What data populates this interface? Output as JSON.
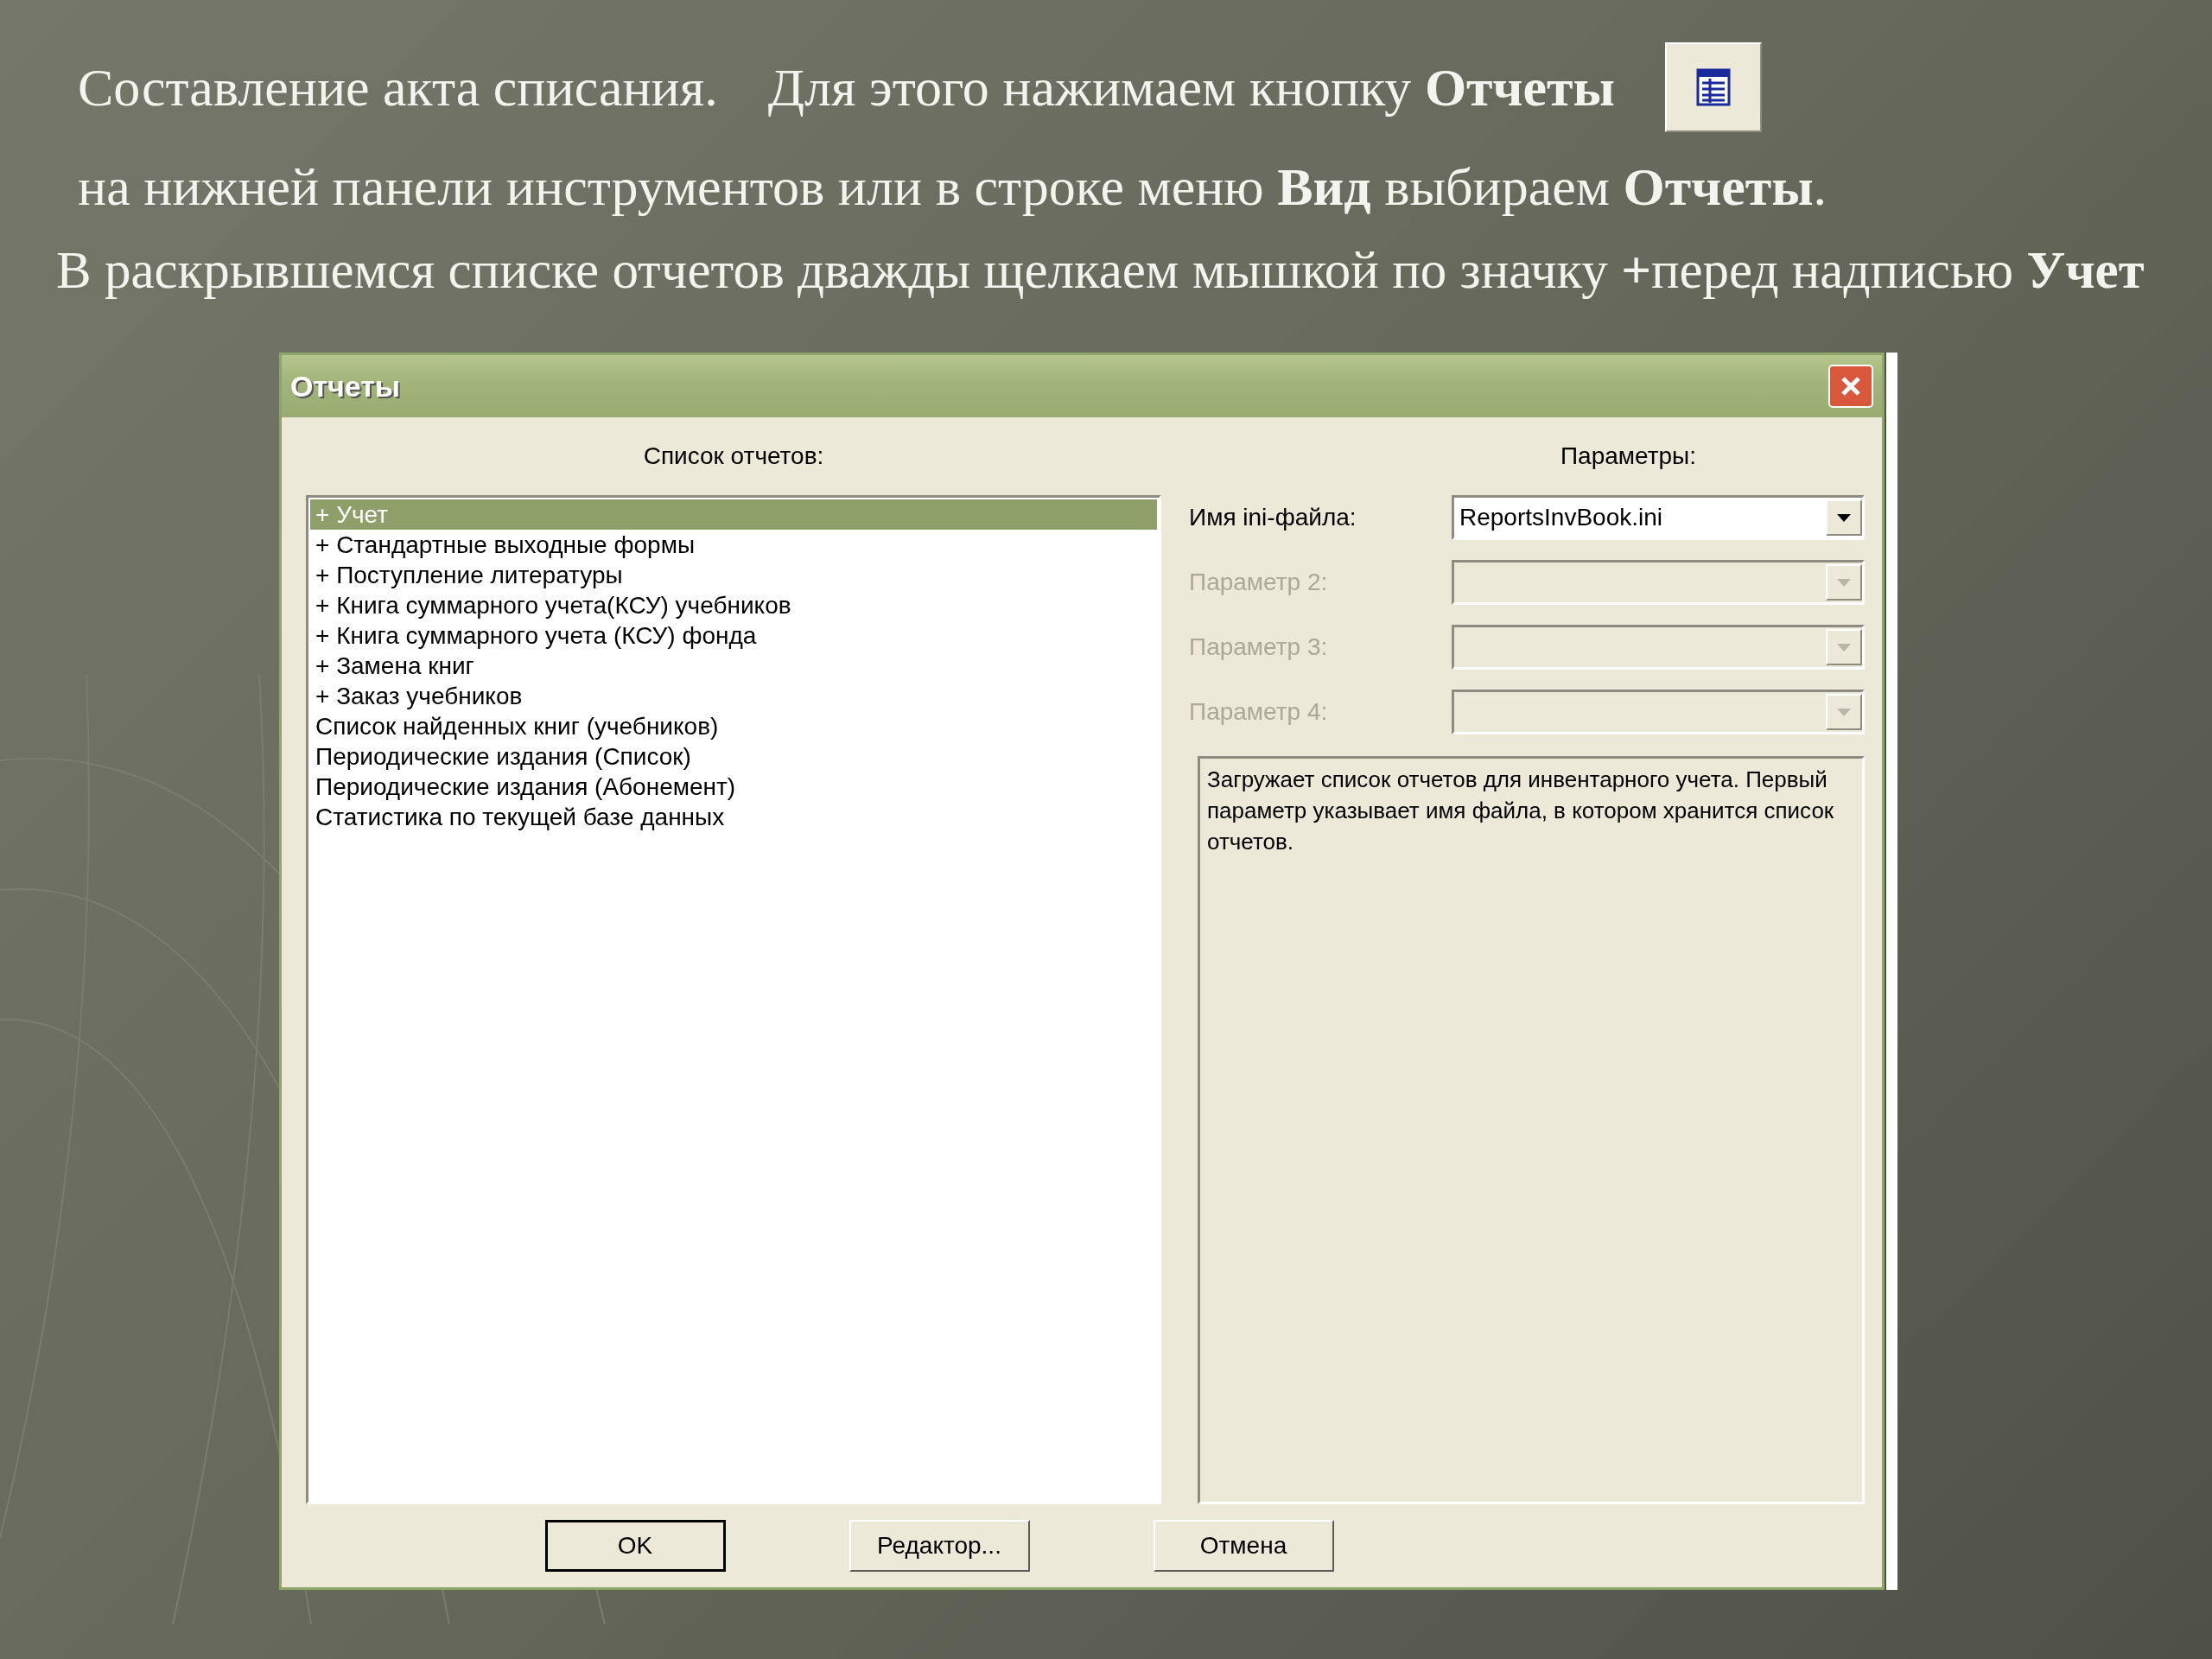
{
  "slide": {
    "lines": [
      {
        "parts": [
          "Составление акта списания.",
          "Для этого нажимаем кнопку **Отчеты**"
        ],
        "toolbar_button": true
      },
      {
        "parts": [
          "на нижней панели инструментов или в строке меню **Вид** выбираем **Отчеты**."
        ],
        "toolbar_button": false
      },
      {
        "parts": [
          "В раскрывшемся списке отчетов дважды щелкаем мышкой по значку **+**перед надписью **Учет**"
        ],
        "toolbar_button": false
      }
    ]
  },
  "dialog": {
    "title": "Отчеты",
    "list_title": "Список отчетов:",
    "reports": [
      {
        "label": "+ Учет",
        "selected": true
      },
      {
        "label": "+ Стандартные выходные формы",
        "selected": false
      },
      {
        "label": "+ Поступление литературы",
        "selected": false
      },
      {
        "label": "+ Книга суммарного учета(КСУ) учебников",
        "selected": false
      },
      {
        "label": "+ Книга суммарного учета (КСУ) фонда",
        "selected": false
      },
      {
        "label": "+ Замена книг",
        "selected": false
      },
      {
        "label": "+ Заказ учебников",
        "selected": false
      },
      {
        "label": "Список найденных книг (учебников)",
        "selected": false
      },
      {
        "label": "Периодические издания (Список)",
        "selected": false
      },
      {
        "label": "Периодические издания (Абонемент)",
        "selected": false
      },
      {
        "label": "Статистика по текущей базе данных",
        "selected": false
      }
    ],
    "parameters_title": "Параметры:",
    "params": [
      {
        "label": "Имя ini-файла:",
        "value": "ReportsInvBook.ini",
        "disabled": false
      },
      {
        "label": "Параметр 2:",
        "disabled": true
      },
      {
        "label": "Параметр 3:",
        "disabled": true
      },
      {
        "label": "Параметр 4:",
        "disabled": true
      }
    ],
    "description": "Загружает список отчетов для инвентарного учета. Первый параметр указывает имя файла, в котором хранится список отчетов.",
    "buttons": [
      {
        "label": "OK",
        "default": true
      },
      {
        "label": "Редактор...",
        "default": false
      },
      {
        "label": "Отмена",
        "default": false
      }
    ]
  }
}
